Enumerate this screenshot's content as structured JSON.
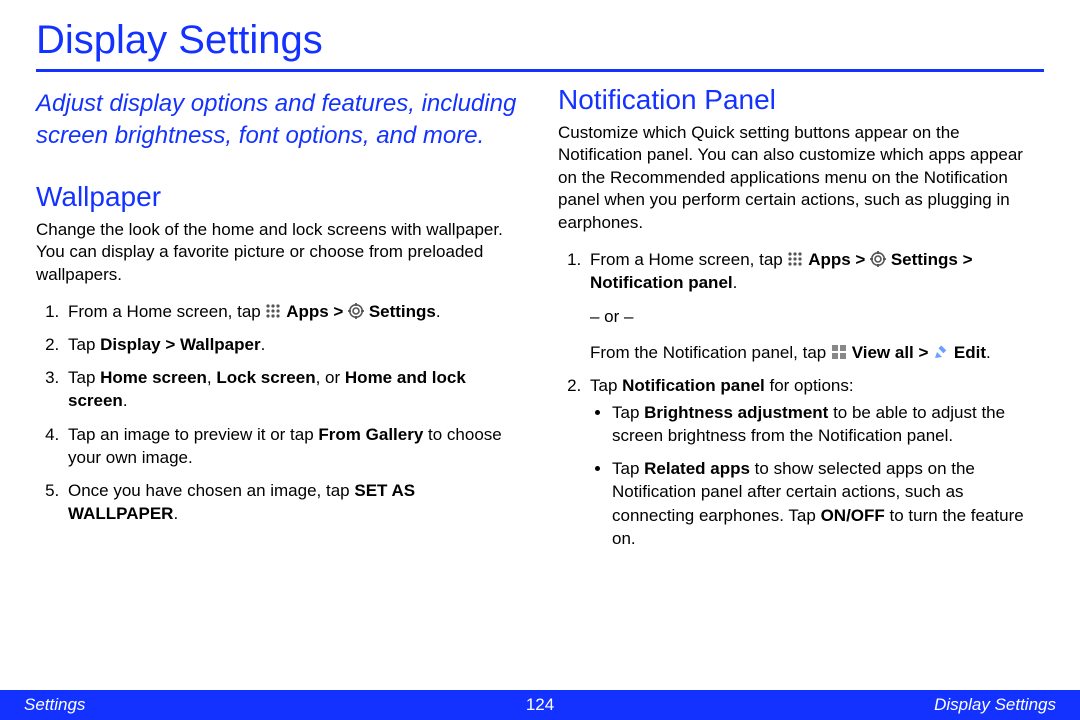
{
  "title": "Display Settings",
  "intro": "Adjust display options and features, including screen brightness, font options, and more.",
  "wallpaper": {
    "heading": "Wallpaper",
    "desc": "Change the look of the home and lock screens with wallpaper. You can display a favorite picture or choose from preloaded wallpapers.",
    "s1a": "From a Home screen, tap ",
    "s1b": " Apps > ",
    "s1c": " Settings",
    "s2a": "Tap ",
    "s2b": "Display > Wallpaper",
    "s3a": "Tap ",
    "s3b": "Home screen",
    "s3c": ", ",
    "s3d": "Lock screen",
    "s3e": ", or ",
    "s3f": "Home and lock screen",
    "s4a": "Tap an image to preview it or tap ",
    "s4b": "From Gallery",
    "s4c": " to choose your own image.",
    "s5a": "Once you have chosen an image, tap ",
    "s5b": "SET AS WALLPAPER"
  },
  "notif": {
    "heading": "Notification Panel",
    "desc": "Customize which Quick setting buttons appear on the Notification panel. You can also customize which apps appear on the Recommended applications menu on the Notification panel when you perform certain actions, such as plugging in earphones.",
    "s1a": "From a Home screen, tap ",
    "s1b": " Apps > ",
    "s1c": " Settings > Notification panel",
    "or": "– or –",
    "s1d": "From the Notification panel, tap ",
    "s1e": " View all > ",
    "s1f": " Edit",
    "s2a": "Tap ",
    "s2b": "Notification panel",
    "s2c": " for options:",
    "b1a": "Tap ",
    "b1b": "Brightness adjustment",
    "b1c": " to be able to adjust the screen brightness from the Notification panel.",
    "b2a": "Tap ",
    "b2b": "Related apps",
    "b2c": " to show selected apps on the Notification panel after certain actions, such as connecting earphones. Tap ",
    "b2d": "ON/OFF",
    "b2e": " to turn the feature on."
  },
  "footer": {
    "left": "Settings",
    "page": "124",
    "right": "Display Settings"
  },
  "period": "."
}
